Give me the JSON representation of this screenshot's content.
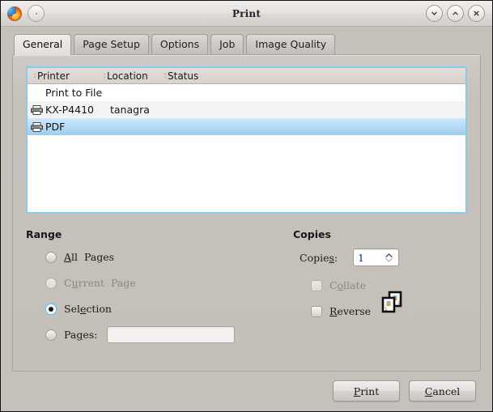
{
  "window": {
    "title": "Print",
    "app_icon": "firefox-icon",
    "menu_dot": "window-menu-button",
    "controls": [
      {
        "name": "minimize-button",
        "icon": "chevron-down-icon"
      },
      {
        "name": "maximize-button",
        "icon": "chevron-up-icon"
      },
      {
        "name": "close-button",
        "icon": "close-x-icon"
      }
    ]
  },
  "tabs": [
    {
      "label": "General",
      "active": true
    },
    {
      "label": "Page Setup",
      "active": false
    },
    {
      "label": "Options",
      "active": false
    },
    {
      "label": "Job",
      "active": false
    },
    {
      "label": "Image Quality",
      "active": false
    }
  ],
  "printer_list": {
    "columns": [
      "Printer",
      "Location",
      "Status"
    ],
    "separator": ":",
    "rows": [
      {
        "icon": "",
        "printer": "Print to File",
        "location": "",
        "status": "",
        "selected": false
      },
      {
        "icon": "printer-icon",
        "printer": "KX-P4410",
        "location": "tanagra",
        "status": "",
        "selected": false
      },
      {
        "icon": "printer-icon",
        "printer": "PDF",
        "location": "",
        "status": "",
        "selected": true
      }
    ]
  },
  "range": {
    "title": "Range",
    "options": [
      {
        "label_pre": "A",
        "label_mn": "A",
        "label_post": "ll  Pages",
        "text": "All  Pages",
        "checked": false,
        "disabled": false
      },
      {
        "text": "Current  Page",
        "checked": false,
        "disabled": true
      },
      {
        "text": "Selection",
        "checked": true,
        "disabled": false
      },
      {
        "text": "Pages:",
        "checked": false,
        "disabled": false
      }
    ],
    "pages_input_value": "",
    "pages_input_placeholder": ""
  },
  "copies": {
    "title": "Copies",
    "copies_label": "Copies:",
    "copies_value": "1",
    "collate_label": "Collate",
    "collate_checked": false,
    "collate_disabled": true,
    "reverse_label": "Reverse",
    "reverse_checked": false,
    "reverse_disabled": false,
    "preview_icon": "collate-preview-icon",
    "preview_page_numbers": [
      "1",
      "2"
    ]
  },
  "actions": {
    "print_label": "Print",
    "cancel_label": "Cancel"
  },
  "colors": {
    "dialog_bg": "#c5bfba",
    "selection": "#b6dbf5",
    "focus_border": "#86ccf0",
    "disabled_text": "#8d8781"
  }
}
